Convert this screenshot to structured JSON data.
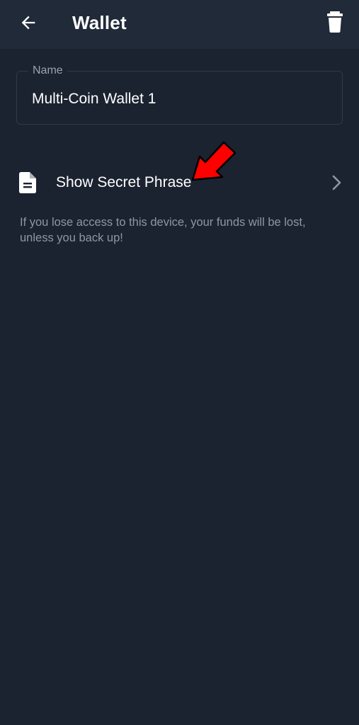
{
  "header": {
    "title": "Wallet",
    "back_icon": "arrow-left-icon",
    "delete_icon": "trash-icon"
  },
  "name_field": {
    "label": "Name",
    "value": "Multi-Coin Wallet 1"
  },
  "secret_phrase_row": {
    "label": "Show Secret Phrase",
    "icon": "document-icon",
    "chevron_icon": "chevron-right-icon"
  },
  "warning": {
    "text": "If you lose access to this device, your funds will be lost, unless you back up!"
  },
  "annotation": {
    "icon": "red-arrow-annotation-icon",
    "color": "#ff0000"
  },
  "colors": {
    "background": "#1b2230",
    "app_bar": "#202a38",
    "muted_text": "#8e97a3"
  }
}
